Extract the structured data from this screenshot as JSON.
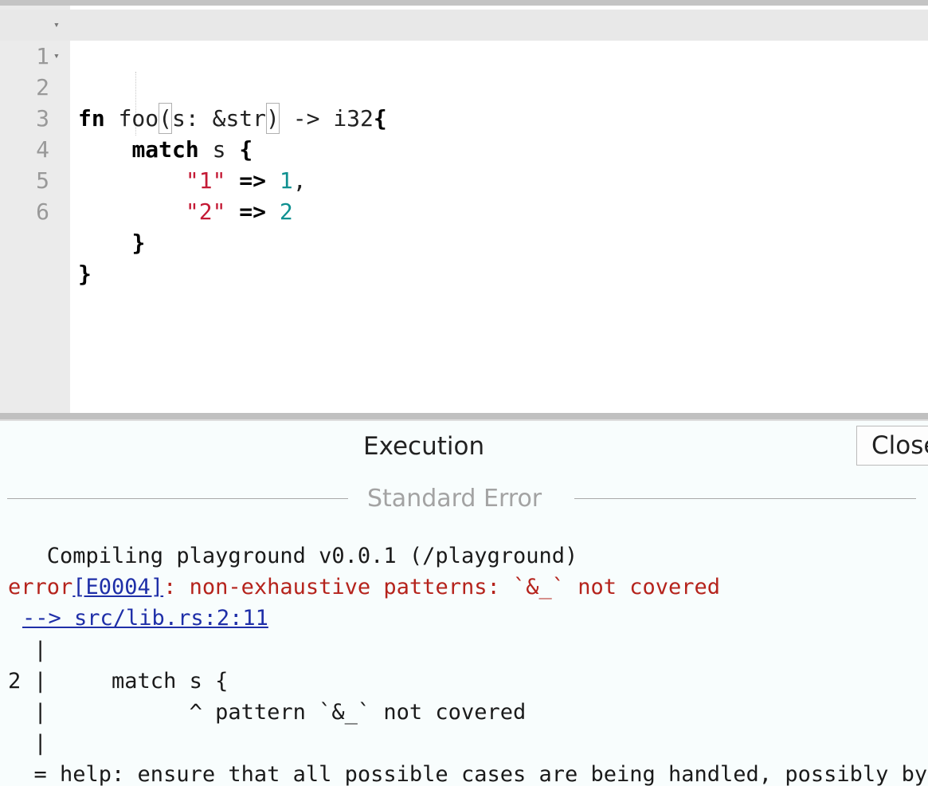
{
  "editor": {
    "lines": [
      {
        "num": "1",
        "fold": "▾"
      },
      {
        "num": "2",
        "fold": "▾"
      },
      {
        "num": "3",
        "fold": ""
      },
      {
        "num": "4",
        "fold": ""
      },
      {
        "num": "5",
        "fold": ""
      },
      {
        "num": "6",
        "fold": ""
      }
    ],
    "code": {
      "l1_kw": "fn",
      "l1_name": " foo",
      "l1_open": "(",
      "l1_params": "s: &str",
      "l1_close": ")",
      "l1_ret": " -> i32",
      "l1_brace": "{",
      "l2_indent": "    ",
      "l2_kw": "match",
      "l2_rest": " s ",
      "l2_brace": "{",
      "l3_indent": "        ",
      "l3_str": "\"1\"",
      "l3_arrow": " => ",
      "l3_num": "1",
      "l3_comma": ",",
      "l4_indent": "        ",
      "l4_str": "\"2\"",
      "l4_arrow": " => ",
      "l4_num": "2",
      "l5_indent": "    ",
      "l5_brace": "}",
      "l6_brace": "}"
    }
  },
  "output": {
    "title": "Execution",
    "close_label": "Close",
    "section_label": "Standard Error",
    "compiling": "   Compiling playground v0.0.1 (/playground)",
    "error_prefix": "error",
    "error_code": "[E0004]",
    "error_message": ": non-exhaustive patterns: `&_` not covered",
    "location_link": "--> src/lib.rs:2:11",
    "gutter1": "  |",
    "snippet_line": "2 |     match s {",
    "pointer_line": "  |           ^ pattern `&_` not covered",
    "gutter2": "  |",
    "help_line": "  = help: ensure that all possible cases are being handled, possibly by adding wildcards or more match arms"
  }
}
